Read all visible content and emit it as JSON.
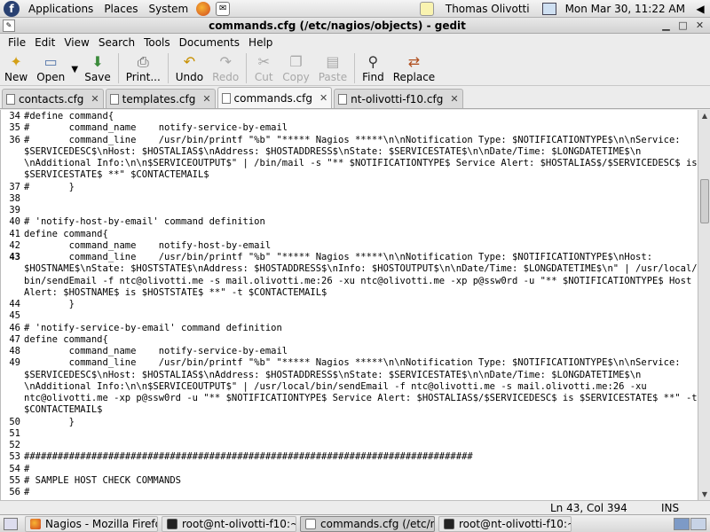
{
  "top_panel": {
    "menus": [
      "Applications",
      "Places",
      "System"
    ],
    "user": "Thomas Olivotti",
    "clock": "Mon Mar 30, 11:22 AM"
  },
  "window": {
    "title": "commands.cfg (/etc/nagios/objects) - gedit"
  },
  "menubar": [
    "File",
    "Edit",
    "View",
    "Search",
    "Tools",
    "Documents",
    "Help"
  ],
  "toolbar": {
    "new": "New",
    "open": "Open",
    "save": "Save",
    "print": "Print...",
    "undo": "Undo",
    "redo": "Redo",
    "cut": "Cut",
    "copy": "Copy",
    "paste": "Paste",
    "find": "Find",
    "replace": "Replace"
  },
  "tabs": [
    "contacts.cfg",
    "templates.cfg",
    "commands.cfg",
    "nt-olivotti-f10.cfg"
  ],
  "editor": {
    "line_numbers": [
      {
        "n": "34",
        "row": 0
      },
      {
        "n": "35",
        "row": 1
      },
      {
        "n": "36",
        "row": 2
      },
      {
        "n": "37",
        "row": 6
      },
      {
        "n": "38",
        "row": 7
      },
      {
        "n": "39",
        "row": 8
      },
      {
        "n": "40",
        "row": 9
      },
      {
        "n": "41",
        "row": 10
      },
      {
        "n": "42",
        "row": 11
      },
      {
        "n": "43",
        "row": 12
      },
      {
        "n": "44",
        "row": 16
      },
      {
        "n": "45",
        "row": 17
      },
      {
        "n": "46",
        "row": 18
      },
      {
        "n": "47",
        "row": 19
      },
      {
        "n": "48",
        "row": 20
      },
      {
        "n": "49",
        "row": 21
      },
      {
        "n": "50",
        "row": 26
      },
      {
        "n": "51",
        "row": 27
      },
      {
        "n": "52",
        "row": 28
      },
      {
        "n": "53",
        "row": 29
      },
      {
        "n": "54",
        "row": 30
      },
      {
        "n": "55",
        "row": 31
      },
      {
        "n": "56",
        "row": 32
      }
    ],
    "current_line": "43",
    "rows": [
      "#define command{",
      "#       command_name    notify-service-by-email",
      "#       command_line    /usr/bin/printf \"%b\" \"***** Nagios *****\\n\\nNotification Type: $NOTIFICATIONTYPE$\\n\\nService:",
      "$SERVICEDESC$\\nHost: $HOSTALIAS$\\nAddress: $HOSTADDRESS$\\nState: $SERVICESTATE$\\n\\nDate/Time: $LONGDATETIME$\\n",
      "\\nAdditional Info:\\n\\n$SERVICEOUTPUT$\" | /bin/mail -s \"** $NOTIFICATIONTYPE$ Service Alert: $HOSTALIAS$/$SERVICEDESC$ is",
      "$SERVICESTATE$ **\" $CONTACTEMAIL$",
      "#       }",
      "",
      "",
      "# 'notify-host-by-email' command definition",
      "define command{",
      "        command_name    notify-host-by-email",
      "        command_line    /usr/bin/printf \"%b\" \"***** Nagios *****\\n\\nNotification Type: $NOTIFICATIONTYPE$\\nHost:",
      "$HOSTNAME$\\nState: $HOSTSTATE$\\nAddress: $HOSTADDRESS$\\nInfo: $HOSTOUTPUT$\\n\\nDate/Time: $LONGDATETIME$\\n\" | /usr/local/",
      "bin/sendEmail -f ntc@olivotti.me -s mail.olivotti.me:26 -xu ntc@olivotti.me -xp p@ssw0rd -u \"** $NOTIFICATIONTYPE$ Host",
      "Alert: $HOSTNAME$ is $HOSTSTATE$ **\" -t $CONTACTEMAIL$",
      "        }",
      "",
      "# 'notify-service-by-email' command definition",
      "define command{",
      "        command_name    notify-service-by-email",
      "        command_line    /usr/bin/printf \"%b\" \"***** Nagios *****\\n\\nNotification Type: $NOTIFICATIONTYPE$\\n\\nService:",
      "$SERVICEDESC$\\nHost: $HOSTALIAS$\\nAddress: $HOSTADDRESS$\\nState: $SERVICESTATE$\\n\\nDate/Time: $LONGDATETIME$\\n",
      "\\nAdditional Info:\\n\\n$SERVICEOUTPUT$\" | /usr/local/bin/sendEmail -f ntc@olivotti.me -s mail.olivotti.me:26 -xu",
      "ntc@olivotti.me -xp p@ssw0rd -u \"** $NOTIFICATIONTYPE$ Service Alert: $HOSTALIAS$/$SERVICEDESC$ is $SERVICESTATE$ **\" -t",
      "$CONTACTEMAIL$",
      "        }",
      "",
      "",
      "################################################################################",
      "#",
      "# SAMPLE HOST CHECK COMMANDS",
      "#"
    ]
  },
  "statusbar": {
    "position": "Ln 43, Col 394",
    "mode": "INS"
  },
  "taskbar": {
    "tasks": [
      {
        "label": "Nagios - Mozilla Firefox",
        "icon": "firefox-icon",
        "active": false
      },
      {
        "label": "root@nt-olivotti-f10:~",
        "icon": "terminal-icon",
        "active": false
      },
      {
        "label": "commands.cfg (/etc/n...",
        "icon": "gedit-icon",
        "active": true
      },
      {
        "label": "root@nt-olivotti-f10:~",
        "icon": "terminal-icon",
        "active": false
      }
    ]
  }
}
